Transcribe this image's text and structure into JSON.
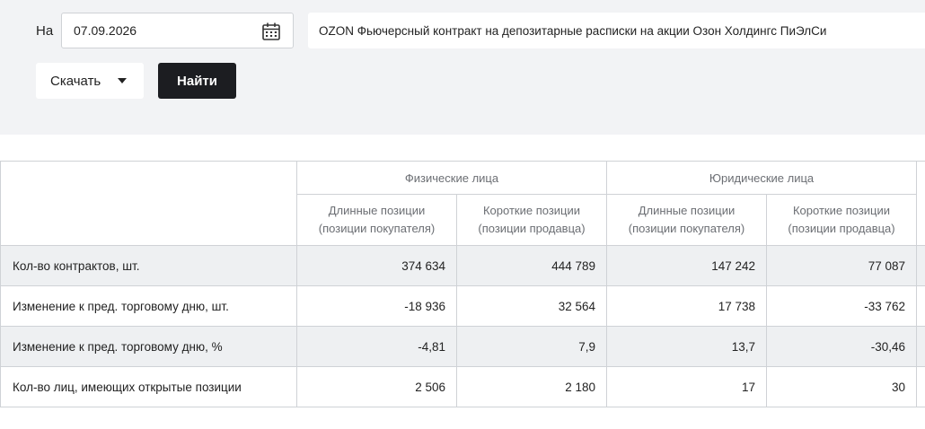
{
  "filters": {
    "date_label": "На",
    "date_value": "07.09.2026",
    "instrument": "OZON Фьючерсный контракт на депозитарные расписки на акции Озон Холдингс ПиЭлСи",
    "download_label": "Скачать",
    "find_label": "Найти"
  },
  "table": {
    "groups": [
      "Физические лица",
      "Юридические лица"
    ],
    "subheaders": [
      {
        "line1": "Длинные позиции",
        "line2": "(позиции покупателя)"
      },
      {
        "line1": "Короткие позиции",
        "line2": "(позиции продавца)"
      },
      {
        "line1": "Длинные позиции",
        "line2": "(позиции покупателя)"
      },
      {
        "line1": "Короткие позиции",
        "line2": "(позиции продавца)"
      }
    ],
    "rows": [
      {
        "label": "Кол-во контрактов, шт.",
        "values": [
          "374 634",
          "444 789",
          "147 242",
          "77 087"
        ]
      },
      {
        "label": "Изменение к пред. торговому дню, шт.",
        "values": [
          "-18 936",
          "32 564",
          "17 738",
          "-33 762"
        ]
      },
      {
        "label": "Изменение к пред. торговому дню, %",
        "values": [
          "-4,81",
          "7,9",
          "13,7",
          "-30,46"
        ]
      },
      {
        "label": "Кол-во лиц, имеющих открытые позиции",
        "values": [
          "2 506",
          "2 180",
          "17",
          "30"
        ]
      }
    ]
  }
}
